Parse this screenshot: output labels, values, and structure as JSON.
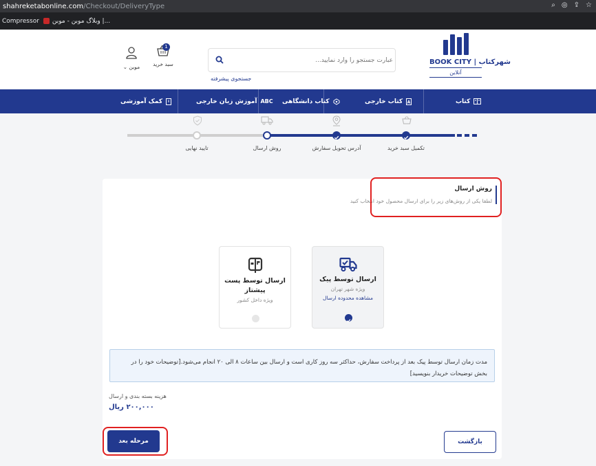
{
  "browser": {
    "url_host": "shahreketabonline.com",
    "url_path": "/Checkout/DeliveryType",
    "bookmarks": [
      {
        "label": "Compressor"
      },
      {
        "label": "وبلاگ موبن - موبن |..."
      }
    ]
  },
  "header": {
    "logo_name": "BOOK CITY | شهرکتاب",
    "logo_sub": "آنلاین",
    "search_placeholder": "عبارت جستجو را وارد نمایید...",
    "advanced_search": "جستجوی پیشرفته",
    "cart_label": "سبد خرید",
    "cart_count": "1",
    "user_label": "موبن"
  },
  "nav": {
    "items": [
      {
        "label": "کتاب"
      },
      {
        "label": "کتاب خارجی"
      },
      {
        "label": "کتاب دانشگاهی"
      },
      {
        "label": "آموزش زبان خارجی"
      },
      {
        "label": "کمک آموزشی"
      }
    ],
    "abc_icon_text": "ABC"
  },
  "steps": {
    "items": [
      {
        "label": "تکمیل سبد خرید",
        "state": "done"
      },
      {
        "label": "آدرس تحویل سفارش",
        "state": "done"
      },
      {
        "label": "روش ارسال",
        "state": "current"
      },
      {
        "label": "تایید نهایی",
        "state": "pending"
      }
    ],
    "colors": {
      "active": "#22398f",
      "inactive": "#cfcfcf"
    }
  },
  "section": {
    "title": "روش ارسال",
    "subtitle": "لطفا یکی از روش‌های زیر را برای ارسال محصول خود انتخاب کنید"
  },
  "options": [
    {
      "title": "ارسال توسط پیک",
      "subtitle": "ویژه شهر تهران",
      "link": "مشاهده محدوده ارسال",
      "selected": true,
      "icon": "delivery-truck-icon"
    },
    {
      "title": "ارسال توسط پست پیشتاز",
      "subtitle": "ویژه داخل کشور",
      "link": "",
      "selected": false,
      "icon": "mailbox-icon"
    }
  ],
  "info_text": "مدت زمان ارسال توسط پیک بعد از پرداخت سفارش، حداکثر سه روز کاری است و ارسال بین ساعات ۸ الی ۲۰ انجام می‌شود.[توضیحات خود را در بخش توضیحات خریدار بنویسید]",
  "cost": {
    "label": "هزینه بسته بندی و ارسال",
    "value": "۲۰۰,۰۰۰ ریال"
  },
  "buttons": {
    "next": "مرحله بعد",
    "back": "بازگشت"
  },
  "theme": {
    "primary": "#22398f",
    "highlight_red": "#e02020"
  }
}
